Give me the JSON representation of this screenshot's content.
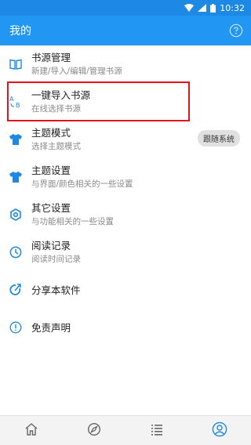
{
  "status_bar": {
    "time": "10:32"
  },
  "app_bar": {
    "title": "我的"
  },
  "menu": [
    {
      "id": "book-source-management",
      "icon": "book-icon",
      "title": "书源管理",
      "subtitle": "新建/导入/编辑/管理书源"
    },
    {
      "id": "one-click-import-source",
      "icon": "translate-icon",
      "title": "一键导入书源",
      "subtitle": "在线选择书源"
    },
    {
      "id": "theme-mode",
      "icon": "tshirt-icon",
      "title": "主题模式",
      "subtitle": "选择主题模式",
      "chip": "跟随系统"
    },
    {
      "id": "theme-settings",
      "icon": "tshirt-icon",
      "title": "主题设置",
      "subtitle": "与界面/颜色相关的一些设置"
    },
    {
      "id": "other-settings",
      "icon": "gear-icon",
      "title": "其它设置",
      "subtitle": "与功能相关的一些设置"
    },
    {
      "id": "reading-history",
      "icon": "clock-icon",
      "title": "阅读记录",
      "subtitle": "阅读时间记录"
    },
    {
      "id": "share-app",
      "icon": "share-icon",
      "title": "分享本软件"
    },
    {
      "id": "disclaimer",
      "icon": "info-icon",
      "title": "免责声明"
    }
  ],
  "bottom_nav": [
    {
      "id": "home",
      "icon": "home-icon"
    },
    {
      "id": "discover",
      "icon": "compass-icon"
    },
    {
      "id": "list",
      "icon": "list-icon"
    },
    {
      "id": "profile",
      "icon": "person-icon",
      "active": true
    }
  ],
  "colors": {
    "primary": "#2196f3",
    "status_bar": "#1e88e5",
    "icon": "#1e88e5",
    "highlight": "#e3121b"
  }
}
